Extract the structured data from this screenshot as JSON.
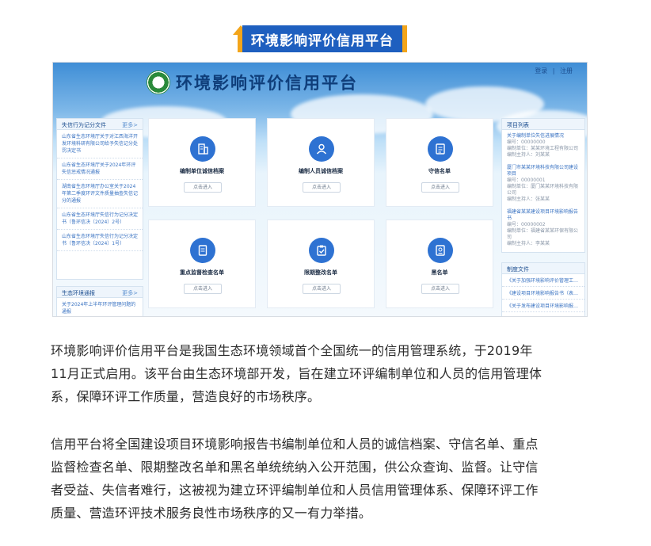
{
  "header_badge": {
    "title": "环境影响评价信用平台"
  },
  "screenshot": {
    "site_title": "环境影响评价信用平台",
    "login_links": [
      "登录",
      "注册"
    ],
    "left_panel_1": {
      "title": "失信行为记分文件",
      "more": "更多>",
      "items": [
        "山东省生态环境厅关于对江西海洋开发环境科研有限公司给予失信记分处罚决定书",
        "山东省生态环境厅关于2024年环评失信惩戒情况通报",
        "湖南省生态环境厅办公室关于2024年第二季度环评文件质量抽查失信记分的通报",
        "山东省生态环境厅失信行为记分决定书（鲁环信决〔2024〕2号）",
        "山东省生态环境厅失信行为记分决定书（鲁环信决〔2024〕1号）"
      ]
    },
    "left_panel_2": {
      "title": "生态环境通报",
      "more": "更多>",
      "items": [
        "关于2024年上半年环评管理问题的通报"
      ]
    },
    "cards": [
      {
        "label": "编制单位诚信档案",
        "button": "点击进入",
        "icon": "building-icon"
      },
      {
        "label": "编制人员诚信档案",
        "button": "点击进入",
        "icon": "person-icon"
      },
      {
        "label": "守信名单",
        "button": "点击进入",
        "icon": "checklist-icon"
      },
      {
        "label": "重点监督检查名单",
        "button": "点击进入",
        "icon": "document-icon"
      },
      {
        "label": "限期整改名单",
        "button": "点击进入",
        "icon": "clipboard-icon"
      },
      {
        "label": "黑名单",
        "button": "点击进入",
        "icon": "blacklist-icon"
      }
    ],
    "right_panel_1": {
      "title": "项目列表",
      "items": [
        {
          "name": "关于编制单位失信进展情况",
          "meta": [
            "编号：00000000",
            "编制单位：某某环境工程有限公司",
            "编制主持人：刘某某"
          ]
        },
        {
          "name": "厦门市某某环境科技有限公司建设项目",
          "meta": [
            "编号：00000001",
            "编制单位：厦门某某环境科技有限公司",
            "编制主持人：张某某"
          ]
        },
        {
          "name": "福建省某某建设项目环境影响报告书",
          "meta": [
            "编号：00000002",
            "编制单位：福建省某某环保有限公司",
            "编制主持人：李某某"
          ]
        }
      ]
    },
    "right_panel_2": {
      "title": "制度文件",
      "items": [
        "《关于加强环境影响评价管理工作的通知》",
        "《建设项目环境影响报告书（表）编制监督管理办法》",
        "《关于发布建设项目环境影响报告书（表）编制能力建设指南的公告》"
      ]
    }
  },
  "paragraphs": [
    [
      "环境影响评价信用平台是我国生态环境领域首个全国统一的信用管理系统，于2019年",
      "11月正式启用。该平台由生态环境部开发，旨在建立环评编制单位和人员的信用管理体",
      "系，保障环评工作质量，营造良好的市场秩序。"
    ],
    [
      "信用平台将全国建设项目环境影响报告书编制单位和人员的诚信档案、守信名单、重点",
      "监督检查名单、限期整改名单和黑名单统统纳入公开范围，供公众查询、监督。让守信",
      "者受益、失信者难行，这被视为建立环评编制单位和人员信用管理体系、保障环评工作",
      "质量、营造环评技术服务良性市场秩序的又一有力举措。"
    ]
  ],
  "colors": {
    "badge_blue": "#1e5fbf",
    "badge_orange": "#f3a51a",
    "card_icon_blue": "#2e72d2",
    "title_navy": "#0f3e7a"
  }
}
